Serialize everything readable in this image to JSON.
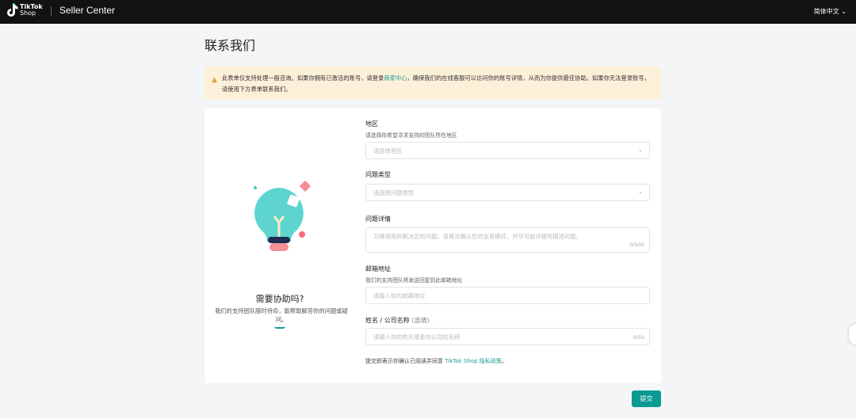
{
  "header": {
    "logo_line1": "TikTok",
    "logo_line2": "Shop",
    "app_name": "Seller Center",
    "language": "简体中文"
  },
  "page": {
    "title": "联系我们"
  },
  "alert": {
    "text_before": "此表单仅支持处理一般咨询。如果你拥有已激活的账号，请登录",
    "link": "商家中心",
    "text_after": "，确保我们的在线客服可以访问你的账号详情，从而为你提供最佳协助。如果你无法登录账号，请使用下方表单联系我们。"
  },
  "help": {
    "title": "需要协助吗?",
    "desc": "我们的支持团队随时待命，能帮助解答你的问题或疑问。"
  },
  "form": {
    "region": {
      "label": "地区",
      "hint": "请选择你希望寻求支持的团队所在地区",
      "placeholder": "请选择地区"
    },
    "type": {
      "label": "问题类型",
      "placeholder": "请选择问题类型"
    },
    "details": {
      "label": "问题详情",
      "placeholder": "为确保高效解决您的问题，请再次确认您的业务模式，并尽可能详细地描述问题。",
      "count": "0/500"
    },
    "email": {
      "label": "邮箱地址",
      "hint": "我们的支持团队将发送回复到此邮箱地址",
      "placeholder": "请输入你的邮箱地址"
    },
    "name": {
      "label": "姓名 / 公司名称",
      "optional": "(选填)",
      "placeholder": "请输入你的姓名或者你公司的名称",
      "count": "0/50"
    },
    "note_before": "提交即表示你确认已阅读并同意 ",
    "note_link": "TikTok Shop 隐私政策",
    "note_after": "。"
  },
  "submit_label": "提交"
}
